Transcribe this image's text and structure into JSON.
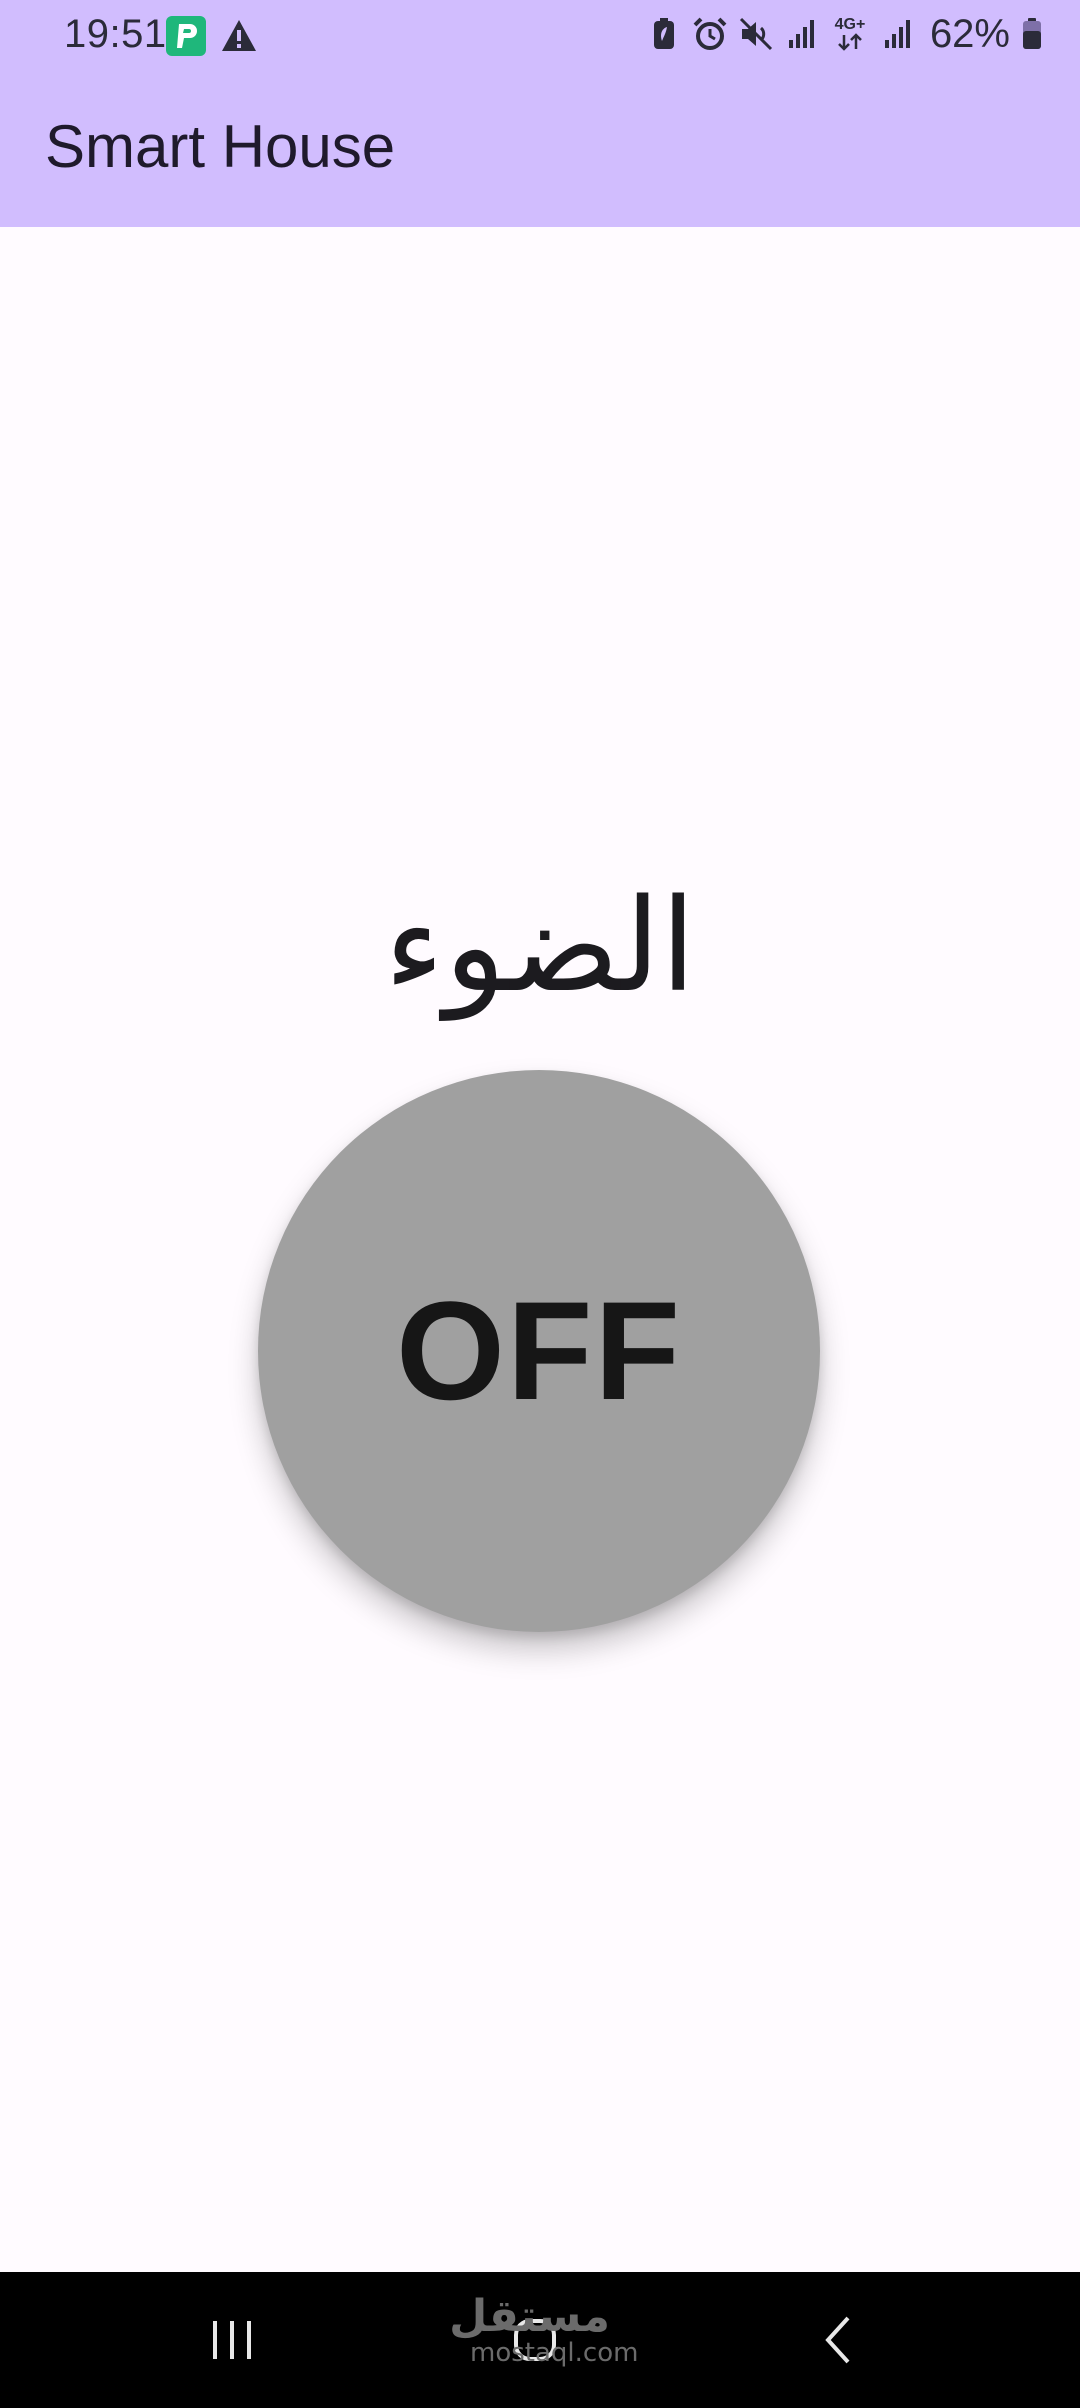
{
  "status_bar": {
    "time": "19:51",
    "battery_percent": "62%",
    "network_label": "4G+",
    "left_icons": [
      "app-p-icon",
      "warning-icon"
    ],
    "right_icons": [
      "battery-saver-icon",
      "alarm-icon",
      "mute-icon",
      "signal-icon",
      "network-4g-icon",
      "signal-icon",
      "battery-icon"
    ]
  },
  "app_bar": {
    "title": "Smart House",
    "background": "#d1bdfe"
  },
  "control": {
    "label": "الضوء",
    "state_text": "OFF",
    "button_color": "#a0a0a0"
  },
  "nav_bar": {
    "items": [
      "recents-icon",
      "home-icon",
      "back-icon"
    ]
  },
  "watermark": {
    "arabic": "مستقل",
    "latin": "mostaql.com"
  }
}
